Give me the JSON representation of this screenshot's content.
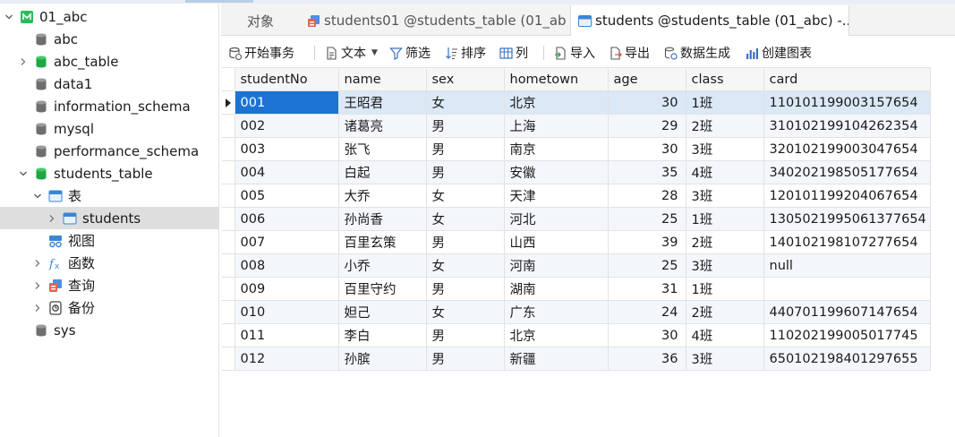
{
  "sidebar": {
    "items": [
      {
        "label": "01_abc",
        "icon": "mysql-connection-icon",
        "expanded": true,
        "depth": 0
      },
      {
        "label": "abc",
        "icon": "database-icon",
        "depth": 1
      },
      {
        "label": "abc_table",
        "icon": "database-icon",
        "open": true,
        "collapsed": true,
        "depth": 1
      },
      {
        "label": "data1",
        "icon": "database-icon",
        "depth": 1
      },
      {
        "label": "information_schema",
        "icon": "database-icon",
        "depth": 1
      },
      {
        "label": "mysql",
        "icon": "database-icon",
        "depth": 1
      },
      {
        "label": "performance_schema",
        "icon": "database-icon",
        "depth": 1
      },
      {
        "label": "students_table",
        "icon": "database-icon",
        "open": true,
        "expanded": true,
        "depth": 1
      },
      {
        "label": "表",
        "icon": "table-folder-icon",
        "expanded": true,
        "depth": 2
      },
      {
        "label": "students",
        "icon": "table-icon",
        "selected": true,
        "collapsed": true,
        "depth": 3
      },
      {
        "label": "视图",
        "icon": "view-icon",
        "depth": 2
      },
      {
        "label": "函数",
        "icon": "function-icon",
        "collapsed": true,
        "depth": 2
      },
      {
        "label": "查询",
        "icon": "query-icon",
        "collapsed": true,
        "depth": 2
      },
      {
        "label": "备份",
        "icon": "backup-icon",
        "collapsed": true,
        "depth": 2
      },
      {
        "label": "sys",
        "icon": "database-icon",
        "depth": 1
      }
    ]
  },
  "tabs": [
    {
      "label": "对象",
      "icon": ""
    },
    {
      "label": "students01 @students_table (01_ab...",
      "icon": "query-tab-icon"
    },
    {
      "label": "students @students_table (01_abc) -...",
      "icon": "table-tab-icon",
      "active": true
    }
  ],
  "toolbar": {
    "begin_transaction": "开始事务",
    "text": "文本",
    "filter": "筛选",
    "sort": "排序",
    "columns": "列",
    "import": "导入",
    "export": "导出",
    "data_generation": "数据生成",
    "create_chart": "创建图表"
  },
  "grid": {
    "columns": [
      "studentNo",
      "name",
      "sex",
      "hometown",
      "age",
      "class",
      "card"
    ],
    "rows": [
      [
        "001",
        "王昭君",
        "女",
        "北京",
        "30",
        "1班",
        "110101199003157654"
      ],
      [
        "002",
        "诸葛亮",
        "男",
        "上海",
        "29",
        "2班",
        "310102199104262354"
      ],
      [
        "003",
        "张飞",
        "男",
        "南京",
        "30",
        "3班",
        "320102199003047654"
      ],
      [
        "004",
        "白起",
        "男",
        "安徽",
        "35",
        "4班",
        "340202198505177654"
      ],
      [
        "005",
        "大乔",
        "女",
        "天津",
        "28",
        "3班",
        "120101199204067654"
      ],
      [
        "006",
        "孙尚香",
        "女",
        "河北",
        "25",
        "1班",
        "130502199506137765"
      ],
      [
        "007",
        "百里玄策",
        "男",
        "山西",
        "39",
        "2班",
        "140102198107277654"
      ],
      [
        "008",
        "小乔",
        "女",
        "河南",
        "25",
        "3班",
        "null"
      ],
      [
        "009",
        "百里守约",
        "男",
        "湖南",
        "31",
        "1班",
        ""
      ],
      [
        "010",
        "妲己",
        "女",
        "广东",
        "24",
        "2班",
        "440701199607147654"
      ],
      [
        "011",
        "李白",
        "男",
        "北京",
        "30",
        "4班",
        "110202199005017745"
      ],
      [
        "012",
        "孙膑",
        "男",
        "新疆",
        "36",
        "3班",
        "650102198401297655"
      ]
    ],
    "row6_card": "1305021995061377654"
  },
  "colors": {
    "selection": "#1c73d1",
    "current_row": "#dbe8f6",
    "alt_row": "#f3f7fc",
    "db_green": "#1fb14a",
    "db_gray": "#6e6e6e"
  }
}
